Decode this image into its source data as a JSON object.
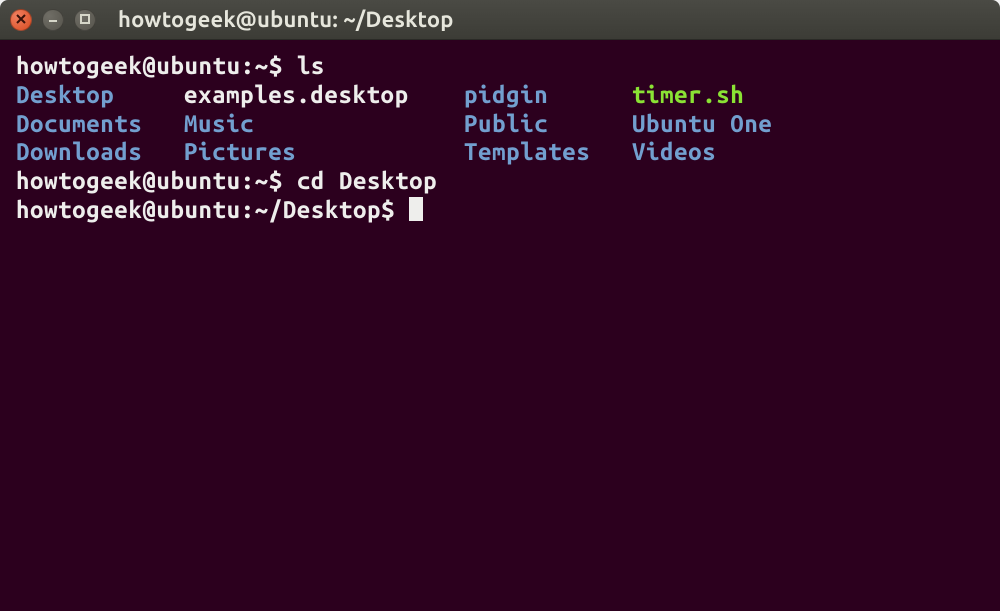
{
  "window": {
    "title": "howtogeek@ubuntu: ~/Desktop"
  },
  "terminal": {
    "prompt1": "howtogeek@ubuntu:~$ ",
    "cmd1": "ls",
    "ls": {
      "row1": {
        "c1": "Desktop",
        "c2": "examples.desktop",
        "c3": "pidgin",
        "c4": "timer.sh"
      },
      "row2": {
        "c1": "Documents",
        "c2": "Music",
        "c3": "Public",
        "c4": "Ubuntu One"
      },
      "row3": {
        "c1": "Downloads",
        "c2": "Pictures",
        "c3": "Templates",
        "c4": "Videos"
      }
    },
    "prompt2": "howtogeek@ubuntu:~$ ",
    "cmd2": "cd Desktop",
    "prompt3": "howtogeek@ubuntu:~/Desktop$ "
  },
  "colors": {
    "bg": "#2c001e",
    "fg": "#eeeeec",
    "dir": "#729fcf",
    "exe": "#8ae234",
    "close": "#d94b20"
  }
}
